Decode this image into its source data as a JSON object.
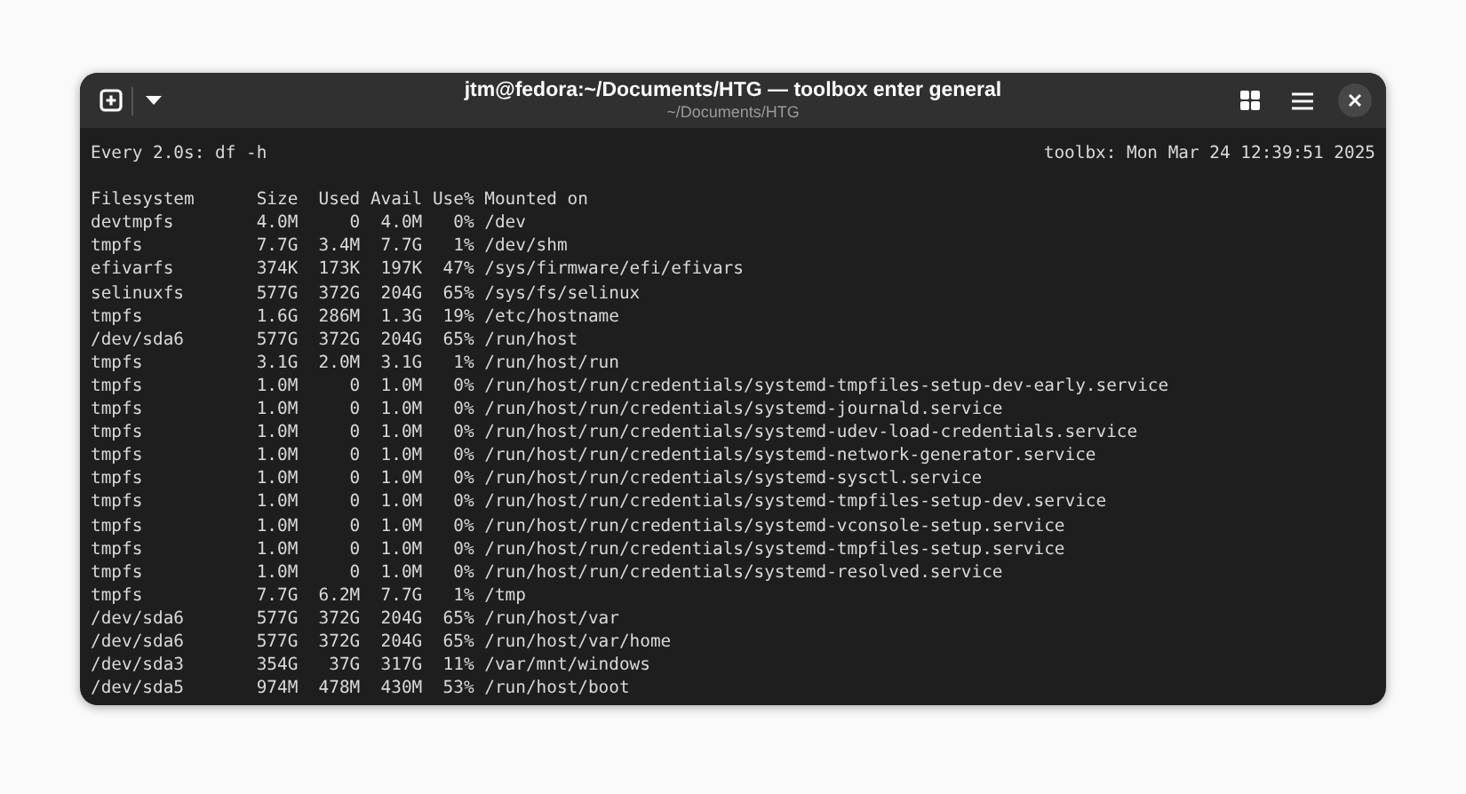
{
  "window": {
    "title": "jtm@fedora:~/Documents/HTG — toolbox enter general",
    "subtitle": "~/Documents/HTG"
  },
  "terminal": {
    "command_line": "Every 2.0s: df -h",
    "clock": "toolbx: Mon Mar 24 12:39:51 2025",
    "lines": [
      "Filesystem      Size  Used Avail Use% Mounted on",
      "devtmpfs        4.0M     0  4.0M   0% /dev",
      "tmpfs           7.7G  3.4M  7.7G   1% /dev/shm",
      "efivarfs        374K  173K  197K  47% /sys/firmware/efi/efivars",
      "selinuxfs       577G  372G  204G  65% /sys/fs/selinux",
      "tmpfs           1.6G  286M  1.3G  19% /etc/hostname",
      "/dev/sda6       577G  372G  204G  65% /run/host",
      "tmpfs           3.1G  2.0M  3.1G   1% /run/host/run",
      "tmpfs           1.0M     0  1.0M   0% /run/host/run/credentials/systemd-tmpfiles-setup-dev-early.service",
      "tmpfs           1.0M     0  1.0M   0% /run/host/run/credentials/systemd-journald.service",
      "tmpfs           1.0M     0  1.0M   0% /run/host/run/credentials/systemd-udev-load-credentials.service",
      "tmpfs           1.0M     0  1.0M   0% /run/host/run/credentials/systemd-network-generator.service",
      "tmpfs           1.0M     0  1.0M   0% /run/host/run/credentials/systemd-sysctl.service",
      "tmpfs           1.0M     0  1.0M   0% /run/host/run/credentials/systemd-tmpfiles-setup-dev.service",
      "tmpfs           1.0M     0  1.0M   0% /run/host/run/credentials/systemd-vconsole-setup.service",
      "tmpfs           1.0M     0  1.0M   0% /run/host/run/credentials/systemd-tmpfiles-setup.service",
      "tmpfs           1.0M     0  1.0M   0% /run/host/run/credentials/systemd-resolved.service",
      "tmpfs           7.7G  6.2M  7.7G   1% /tmp",
      "/dev/sda6       577G  372G  204G  65% /run/host/var",
      "/dev/sda6       577G  372G  204G  65% /run/host/var/home",
      "/dev/sda3       354G   37G  317G  11% /var/mnt/windows",
      "/dev/sda5       974M  478M  430M  53% /run/host/boot"
    ]
  }
}
